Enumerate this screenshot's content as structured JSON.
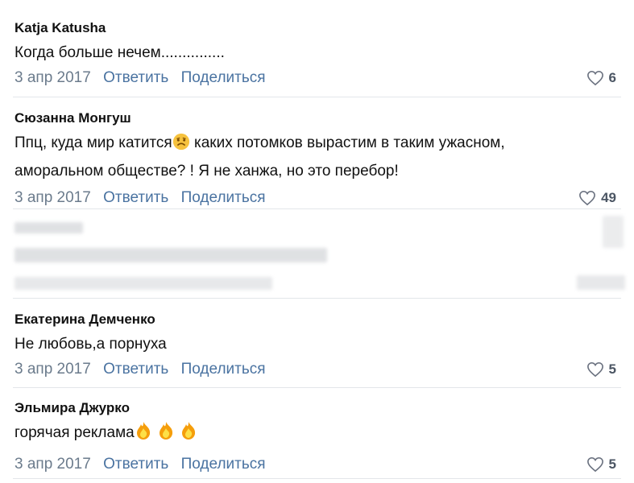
{
  "comments": [
    {
      "author": "Katja Katusha",
      "text_lines": [
        "Когда больше нечем..............."
      ],
      "date": "3 апр 2017",
      "reply": "Ответить",
      "share": "Поделиться",
      "likes": "6"
    },
    {
      "author": "Сюзанна Монгуш",
      "text_a": "Ппц, куда мир катится",
      "text_b": " каких потомков вырастим в таким ужасном,",
      "text_line2": "аморальном обществе?  ! Я не ханжа, но это перебор!",
      "emoji": "sad-face-emoji",
      "date": "3 апр 2017",
      "reply": "Ответить",
      "share": "Поделиться",
      "likes": "49"
    },
    {
      "blurred": true
    },
    {
      "author": "Екатерина Демченко",
      "text_lines": [
        "Не любовь,а порнуха"
      ],
      "date": "3 апр 2017",
      "reply": "Ответить",
      "share": "Поделиться",
      "likes": "5"
    },
    {
      "author": "Эльмира Джурко",
      "text": "горячая реклама",
      "emoji": "fire-emoji",
      "date": "3 апр 2017",
      "reply": "Ответить",
      "share": "Поделиться",
      "likes": "5"
    }
  ],
  "colors": {
    "link": "#4a73a1",
    "meta": "#6b7b8c",
    "divider": "#e3e6ea"
  },
  "icons": {
    "like": "heart-outline-icon"
  }
}
